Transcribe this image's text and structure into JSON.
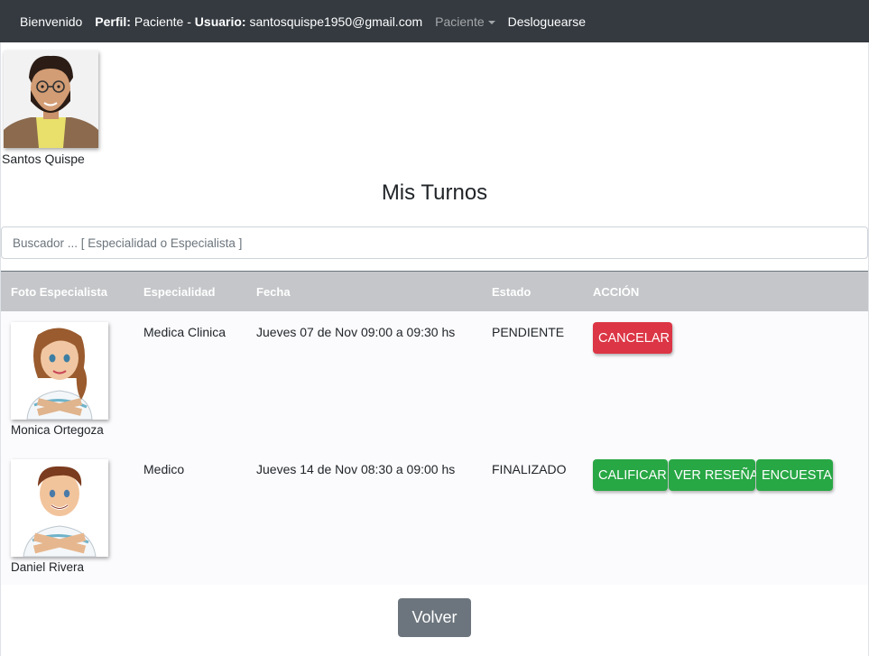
{
  "navbar": {
    "welcome": "Bienvenido",
    "perfil_label": "Perfil:",
    "perfil_value": "Paciente",
    "separator": "-",
    "usuario_label": "Usuario:",
    "usuario_value": "santosquispe1950@gmail.com",
    "dropdown_label": "Paciente",
    "logout": "Desloguearse"
  },
  "profile": {
    "name": "Santos Quispe"
  },
  "page": {
    "title": "Mis Turnos"
  },
  "search": {
    "placeholder": "Buscador ... [ Especialidad o Especialista ]",
    "value": ""
  },
  "table": {
    "headers": [
      "Foto Especialista",
      "Especialidad",
      "Fecha",
      "Estado",
      "ACCIÓN"
    ],
    "rows": [
      {
        "specialist": "Monica Ortegoza",
        "especialidad": "Medica Clinica",
        "fecha": "Jueves 07 de Nov 09:00 a 09:30 hs",
        "estado": "PENDIENTE",
        "actions": [
          "CANCELAR"
        ]
      },
      {
        "specialist": "Daniel Rivera",
        "especialidad": "Medico",
        "fecha": "Jueves 14 de Nov 08:30 a 09:00 hs",
        "estado": "FINALIZADO",
        "actions": [
          "CALIFICAR",
          "VER RESEÑA",
          "ENCUESTA"
        ]
      }
    ]
  },
  "footer": {
    "back_label": "Volver"
  },
  "colors": {
    "navbar": "#343a40",
    "danger": "#dc3545",
    "success": "#28a745",
    "secondary": "#6c757d",
    "table_header": "#c4c6c9"
  }
}
